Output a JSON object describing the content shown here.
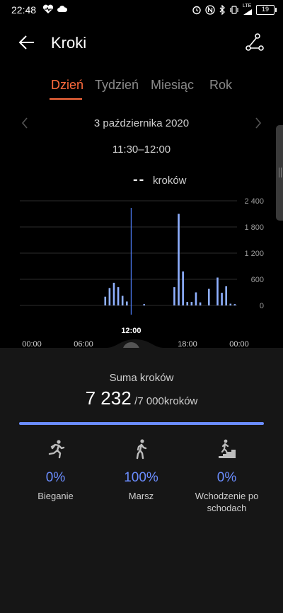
{
  "status": {
    "time": "22:48",
    "lte": "LTE",
    "battery": "19"
  },
  "header": {
    "title": "Kroki"
  },
  "tabs": [
    {
      "label": "Dzień",
      "active": true
    },
    {
      "label": "Tydzień",
      "active": false
    },
    {
      "label": "Miesiąc",
      "active": false
    },
    {
      "label": "Rok",
      "active": false
    }
  ],
  "date": {
    "label": "3 października 2020",
    "range": "11:30–12:00"
  },
  "selection": {
    "steps": "--",
    "unit": "kroków"
  },
  "chart_data": {
    "type": "bar",
    "title": "",
    "xlabel": "",
    "ylabel": "",
    "y_tick_labels": [
      "0",
      "600",
      "1 200",
      "1 800",
      "2 400"
    ],
    "y_ticks": [
      0,
      600,
      1200,
      1800,
      2400
    ],
    "ylim": [
      0,
      2400
    ],
    "x_tick_labels": [
      "00:00",
      "06:00",
      "12:00",
      "18:00",
      "00:00"
    ],
    "x_ticks_hours": [
      0,
      6,
      12,
      18,
      24
    ],
    "selected_label": "12:00",
    "selected_hour": 11.5,
    "bar_interval_minutes": 30,
    "bars": [
      {
        "hour": 8.5,
        "value": 200
      },
      {
        "hour": 9.0,
        "value": 400
      },
      {
        "hour": 9.5,
        "value": 520
      },
      {
        "hour": 10.0,
        "value": 420
      },
      {
        "hour": 10.5,
        "value": 220
      },
      {
        "hour": 11.0,
        "value": 90
      },
      {
        "hour": 13.0,
        "value": 30
      },
      {
        "hour": 16.5,
        "value": 420
      },
      {
        "hour": 17.0,
        "value": 2100
      },
      {
        "hour": 17.5,
        "value": 780
      },
      {
        "hour": 18.0,
        "value": 80
      },
      {
        "hour": 18.5,
        "value": 80
      },
      {
        "hour": 19.0,
        "value": 300
      },
      {
        "hour": 19.5,
        "value": 70
      },
      {
        "hour": 20.5,
        "value": 380
      },
      {
        "hour": 21.5,
        "value": 640
      },
      {
        "hour": 22.0,
        "value": 290
      },
      {
        "hour": 22.5,
        "value": 440
      },
      {
        "hour": 23.0,
        "value": 40
      },
      {
        "hour": 23.5,
        "value": 30
      }
    ],
    "bar_color": "#8fb0ff"
  },
  "summary": {
    "label": "Suma kroków",
    "value": "7 232",
    "goal": "/7 000kroków",
    "progress": 1.0
  },
  "activities": [
    {
      "icon": "running-icon",
      "pct": "0%",
      "label": "Bieganie"
    },
    {
      "icon": "walking-icon",
      "pct": "100%",
      "label": "Marsz"
    },
    {
      "icon": "stairs-icon",
      "pct": "0%",
      "label": "Wchodzenie po schodach"
    }
  ],
  "colors": {
    "accent": "#ff6b3d",
    "blue": "#6b8dff",
    "bar": "#8fb0ff"
  }
}
